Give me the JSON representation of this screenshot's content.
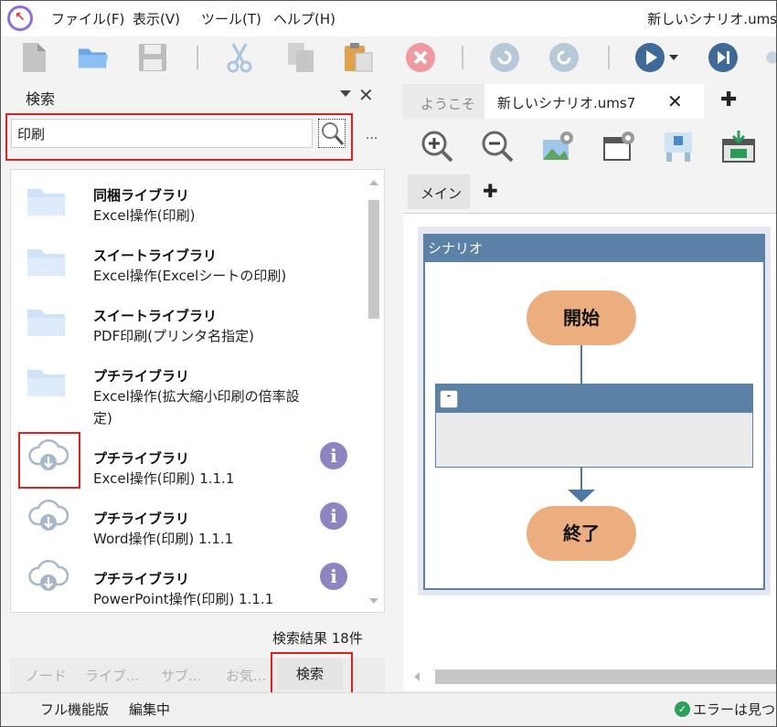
{
  "menubar": {
    "items": [
      "ファイル(F)",
      "表示(V)",
      "ツール(T)",
      "ヘルプ(H)"
    ],
    "window_title": "新しいシナリオ.ums"
  },
  "toolbar": {
    "icons": [
      "new-file-icon",
      "open-folder-icon",
      "save-icon",
      "cut-icon",
      "copy-icon",
      "paste-icon",
      "stop-icon",
      "undo-icon",
      "redo-icon",
      "run-icon",
      "step-icon"
    ]
  },
  "search_panel": {
    "title": "検索",
    "query": "印刷",
    "more": "...",
    "results": [
      {
        "title": "同梱ライブラリ",
        "sub": [
          "Excel操作(印刷)"
        ],
        "icon": "folder-icon",
        "info": false
      },
      {
        "title": "スイートライブラリ",
        "sub": [
          "Excel操作(Excelシートの印刷)"
        ],
        "icon": "folder-icon",
        "info": false
      },
      {
        "title": "スイートライブラリ",
        "sub": [
          "PDF印刷(プリンタ名指定)"
        ],
        "icon": "folder-icon",
        "info": false
      },
      {
        "title": "プチライブラリ",
        "sub": [
          "Excel操作(拡大縮小印刷の倍率設",
          "定)"
        ],
        "icon": "folder-icon",
        "info": false
      },
      {
        "title": "プチライブラリ",
        "sub": [
          "Excel操作(印刷) 1.1.1"
        ],
        "icon": "cloud-download-icon",
        "info": true
      },
      {
        "title": "プチライブラリ",
        "sub": [
          "Word操作(印刷) 1.1.1"
        ],
        "icon": "cloud-download-icon",
        "info": true
      },
      {
        "title": "プチライブラリ",
        "sub": [
          "PowerPoint操作(印刷) 1.1.1"
        ],
        "icon": "cloud-download-icon",
        "info": true
      }
    ],
    "result_count": "検索結果 18件",
    "bottom_tabs": [
      "ノード",
      "ライブ...",
      "サブ...",
      "お気...",
      "検索"
    ]
  },
  "editor": {
    "tabs": [
      "ようこそ",
      "新しいシナリオ.ums7"
    ],
    "tab_close": "✕",
    "tab_add": "✚",
    "sub_tab": "メイン",
    "sub_add": "✚",
    "scenario_label": "シナリオ",
    "start_label": "開始",
    "end_label": "終了",
    "group_collapse": "-"
  },
  "statusbar": {
    "edition": "フル機能版",
    "mode": "編集中",
    "error_text": "エラーは見つか"
  },
  "colors": {
    "accent_red": "#e02020",
    "node_fill": "#ecae7e",
    "scenario_header": "#5b82a6"
  }
}
